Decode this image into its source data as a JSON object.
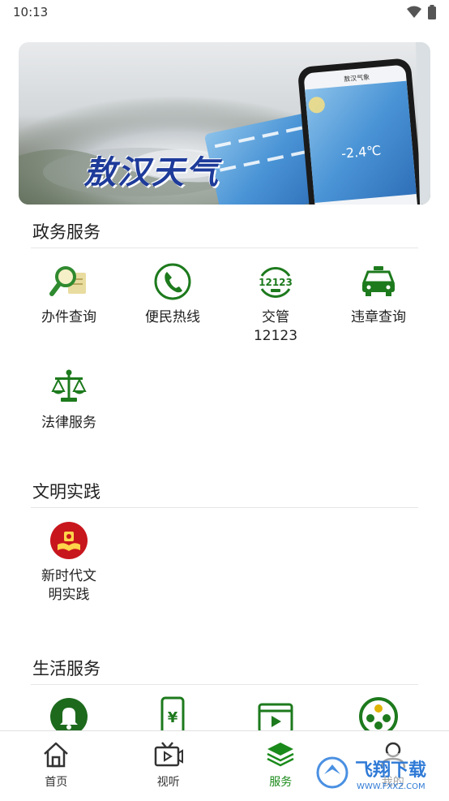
{
  "status": {
    "time": "10:13"
  },
  "banner": {
    "title": "敖汉天气",
    "phone_header": "敖汉气象",
    "temp": "-2.4℃"
  },
  "sections": {
    "gov": {
      "title": "政务服务",
      "items": [
        {
          "label": "办件查询",
          "icon": "search-document-icon"
        },
        {
          "label": "便民热线",
          "icon": "phone-icon"
        },
        {
          "label": "交管\n12123",
          "icon": "traffic-12123-icon"
        },
        {
          "label": "违章查询",
          "icon": "taxi-icon"
        },
        {
          "label": "法律服务",
          "icon": "scales-icon"
        }
      ]
    },
    "civ": {
      "title": "文明实践",
      "items": [
        {
          "label": "新时代文\n明实践",
          "icon": "civilization-book-icon"
        }
      ]
    },
    "life": {
      "title": "生活服务",
      "items": [
        {
          "label": "",
          "icon": "bell-icon"
        },
        {
          "label": "",
          "icon": "mobile-yuan-icon"
        },
        {
          "label": "",
          "icon": "video-clapper-icon"
        },
        {
          "label": "",
          "icon": "film-reel-icon"
        }
      ]
    }
  },
  "nav": {
    "items": [
      {
        "label": "首页",
        "icon": "home-icon"
      },
      {
        "label": "视听",
        "icon": "tv-icon"
      },
      {
        "label": "服务",
        "icon": "layers-icon",
        "active": true
      },
      {
        "label": "我的",
        "icon": "user-icon"
      }
    ]
  },
  "watermark": {
    "text": "飞翔下载",
    "url": "WWW.FXXZ.COM"
  },
  "colors": {
    "accent": "#1a8a1a",
    "banner_title": "#1e3b9a"
  }
}
